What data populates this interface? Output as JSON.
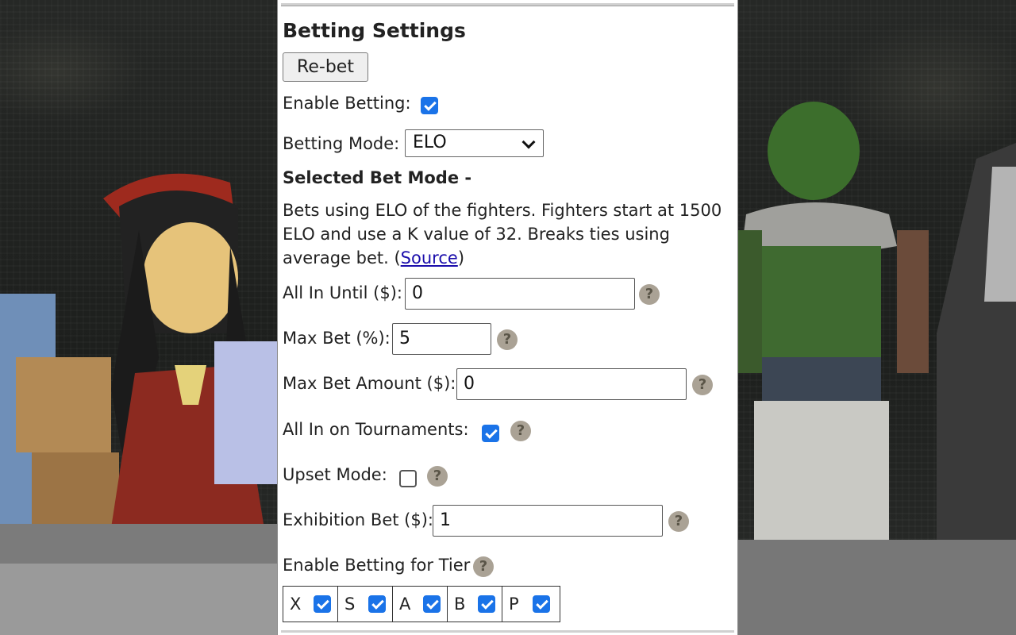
{
  "settings": {
    "title": "Betting Settings",
    "rebet_label": "Re-bet",
    "enable_betting_label": "Enable Betting:",
    "enable_betting": true,
    "betting_mode_label": "Betting Mode:",
    "betting_mode_value": "ELO",
    "selected_mode_heading": "Selected Bet Mode -",
    "mode_description": "Bets using ELO of the fighters. Fighters start at 1500 ELO and use a K value of 32. Breaks ties using average bet. (",
    "source_link": "Source",
    "desc_close": ")",
    "all_in_until_label": "All In Until ($):",
    "all_in_until_value": "0",
    "max_bet_pct_label": "Max Bet (%):",
    "max_bet_pct_value": "5",
    "max_bet_amount_label": "Max Bet Amount ($):",
    "max_bet_amount_value": "0",
    "all_in_tournaments_label": "All In on Tournaments:",
    "all_in_tournaments": true,
    "upset_mode_label": "Upset Mode:",
    "upset_mode": false,
    "exhibition_bet_label": "Exhibition Bet ($):",
    "exhibition_bet_value": "1",
    "tier_label": "Enable Betting for Tier",
    "help_glyph": "?",
    "tiers": [
      {
        "label": "X",
        "checked": true
      },
      {
        "label": "S",
        "checked": true
      },
      {
        "label": "A",
        "checked": true
      },
      {
        "label": "B",
        "checked": true
      },
      {
        "label": "P",
        "checked": true
      }
    ]
  },
  "colors": {
    "checkbox_accent": "#1a73e8",
    "help_badge": "#aaa295",
    "link": "#1a0dab"
  }
}
